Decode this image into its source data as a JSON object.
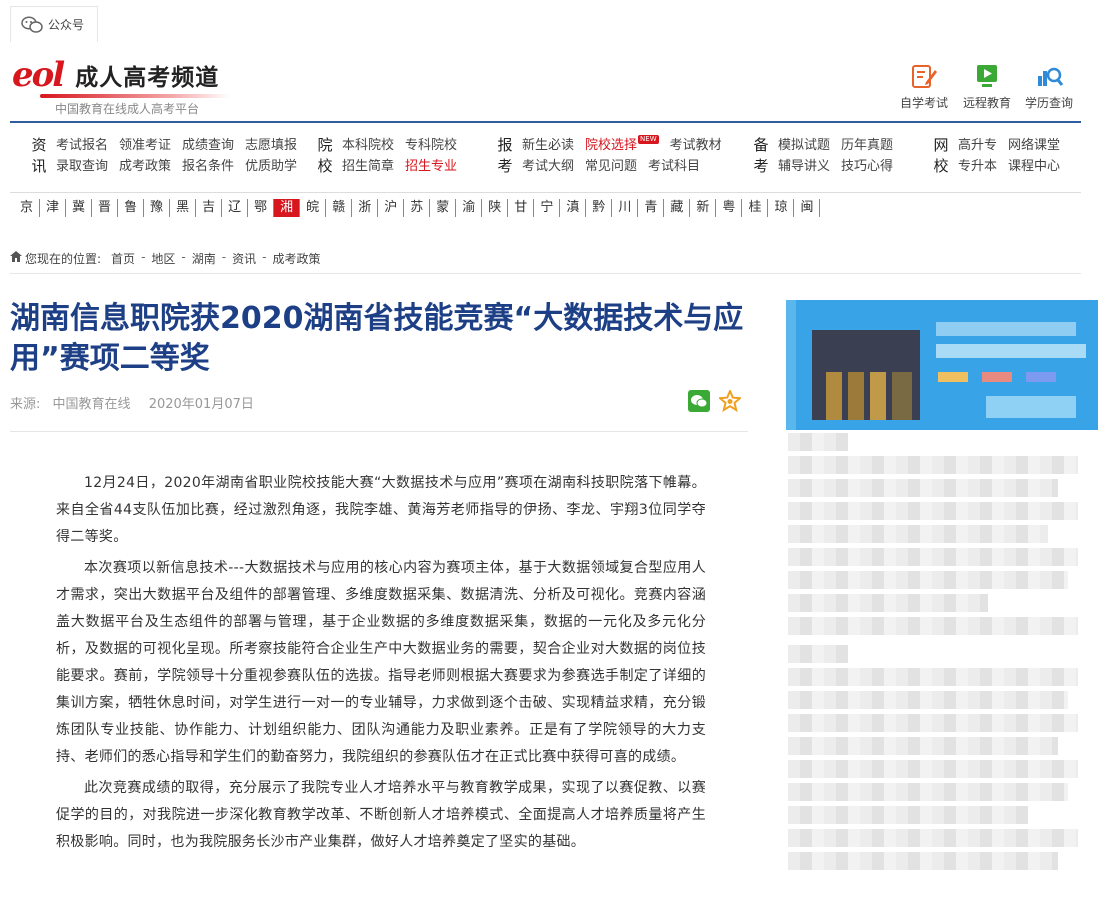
{
  "topbar": {
    "wechat_label": "公众号"
  },
  "brand": {
    "logo_text": "eol",
    "title": "成人高考频道",
    "subtitle": "中国教育在线成人高考平台"
  },
  "quick_links": [
    {
      "label": "自学考试",
      "icon": "pencil-note-icon",
      "color": "#e8622a"
    },
    {
      "label": "远程教育",
      "icon": "video-play-icon",
      "color": "#3aa935"
    },
    {
      "label": "学历查询",
      "icon": "search-chart-icon",
      "color": "#2f8ad8"
    }
  ],
  "nav": {
    "zixun": {
      "cat": [
        "资",
        "讯"
      ],
      "rows": [
        [
          "考试报名",
          "领准考证",
          "成绩查询",
          "志愿填报"
        ],
        [
          "录取查询",
          "成考政策",
          "报名条件",
          "优质助学"
        ]
      ]
    },
    "yuanxiao": {
      "cat": [
        "院",
        "校"
      ],
      "rows": [
        [
          "本科院校",
          "专科院校"
        ],
        [
          "招生简章",
          "招生专业"
        ]
      ]
    },
    "baokao": {
      "cat": [
        "报",
        "考"
      ],
      "rows": [
        [
          "新生必读",
          "院校选择",
          "考试教材"
        ],
        [
          "考试大纲",
          "常见问题",
          "考试科目"
        ]
      ],
      "new_badge": "NEW"
    },
    "beikao": {
      "cat": [
        "备",
        "考"
      ],
      "rows": [
        [
          "模拟试题",
          "历年真题"
        ],
        [
          "辅导讲义",
          "技巧心得"
        ]
      ]
    },
    "wangxiao": {
      "cat": [
        "网",
        "校"
      ],
      "rows": [
        [
          "高升专",
          "网络课堂"
        ],
        [
          "专升本",
          "课程中心"
        ]
      ]
    }
  },
  "provinces": [
    "京",
    "津",
    "冀",
    "晋",
    "鲁",
    "豫",
    "黑",
    "吉",
    "辽",
    "鄂",
    "湘",
    "皖",
    "赣",
    "浙",
    "沪",
    "苏",
    "蒙",
    "渝",
    "陕",
    "甘",
    "宁",
    "滇",
    "黔",
    "川",
    "青",
    "藏",
    "新",
    "粤",
    "桂",
    "琼",
    "闽"
  ],
  "active_province": "湘",
  "breadcrumb": {
    "label": "您现在的位置:",
    "items": [
      "首页",
      "地区",
      "湖南",
      "资讯",
      "成考政策"
    ]
  },
  "article": {
    "title": "湖南信息职院获2020湖南省技能竞赛“大数据技术与应用”赛项二等奖",
    "source_label": "来源:",
    "source": "中国教育在线",
    "date": "2020年01月07日",
    "paragraphs": [
      "12月24日，2020年湖南省职业院校技能大赛“大数据技术与应用”赛项在湖南科技职院落下帷幕。来自全省44支队伍加比赛，经过激烈角逐，我院李雄、黄海芳老师指导的伊扬、李龙、宇翔3位同学夺得二等奖。",
      "本次赛项以新信息技术---大数据技术与应用的核心内容为赛项主体，基于大数据领域复合型应用人才需求，突出大数据平台及组件的部署管理、多维度数据采集、数据清洗、分析及可视化。竞赛内容涵盖大数据平台及生态组件的部署与管理，基于企业数据的多维度数据采集，数据的一元化及多元化分析，及数据的可视化呈现。所考察技能符合企业生产中大数据业务的需要，契合企业对大数据的岗位技能要求。赛前，学院领导十分重视参赛队伍的选拔。指导老师则根据大赛要求为参赛选手制定了详细的集训方案，牺牲休息时间，对学生进行一对一的专业辅导，力求做到逐个击破、实现精益求精，充分锻炼团队专业技能、协作能力、计划组织能力、团队沟通能力及职业素养。正是有了学院领导的大力支持、老师们的悉心指导和学生们的勤奋努力，我院组织的参赛队伍才在正式比赛中获得可喜的成绩。",
      "此次竞赛成绩的取得，充分展示了我院专业人才培养水平与教育教学成果，实现了以赛促教、以赛促学的目的，对我院进一步深化教育教学改革、不断创新人才培养模式、全面提高人才培养质量将产生积极影响。同时，也为我院服务长沙市产业集群，做好人才培养奠定了坚实的基础。"
    ]
  },
  "colors": {
    "brand_red": "#d7161e",
    "title_blue": "#1d3f86",
    "nav_border": "#2f5c9e"
  }
}
